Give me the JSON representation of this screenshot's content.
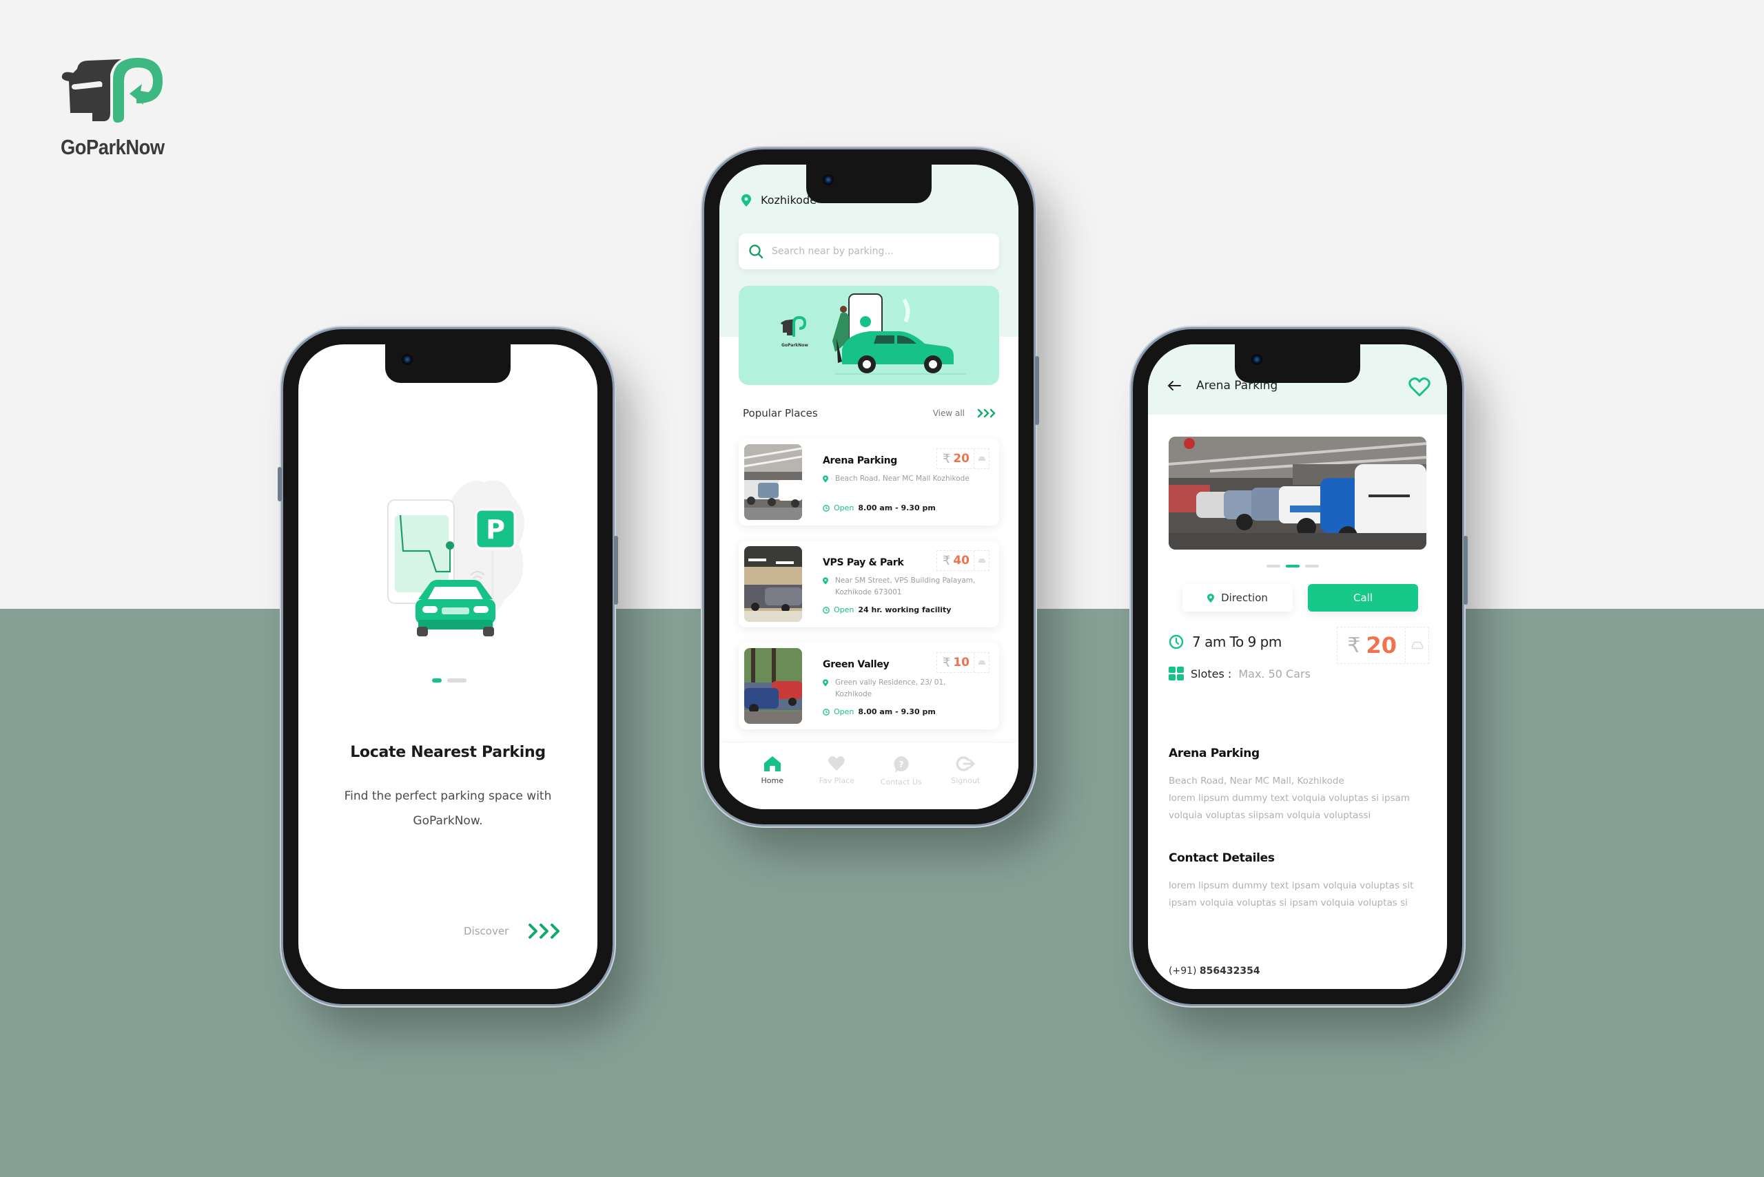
{
  "brand": {
    "name": "GoParkNow",
    "primary_color": "#16c287",
    "dark_color": "#3a3a3a",
    "price_color": "#f0734d"
  },
  "onboarding": {
    "title": "Locate Nearest Parking",
    "subtitle_line1": "Find the perfect parking space with",
    "subtitle_line2": "GoParkNow.",
    "pager": {
      "current": 1,
      "total": 2
    },
    "discover_label": "Discover",
    "discover_icon": "triple-chevron-right-icon",
    "illustration": "car-parking-map-illustration"
  },
  "home": {
    "location": "Kozhikode",
    "search_placeholder": "Search near by parking...",
    "banner": {
      "brand": "GoParkNow",
      "illustration": "person-with-green-car-and-phone-map"
    },
    "section_title": "Popular Places",
    "view_all_label": "View all",
    "currency_symbol": "₹",
    "places": [
      {
        "name": "Arena Parking",
        "price": "20",
        "address": "Beach Road, Near MC Mall Kozhikode",
        "status": "Open",
        "hours": "8.00 am - 9.30 pm",
        "image": "indoor-parking-garage"
      },
      {
        "name": "VPS Pay & Park",
        "price": "40",
        "address": "Near SM Street, VPS Building Palayam, Kozhikode 673001",
        "status": "Open",
        "hours": "24 hr. working facility",
        "image": "basement-parking-lot"
      },
      {
        "name": "Green Valley",
        "price": "10",
        "address": "Green vally Residence, 23/ 01, Kozhikode",
        "status": "Open",
        "hours": "8.00 am - 9.30 pm",
        "image": "outdoor-parking-trees"
      }
    ],
    "nav": [
      {
        "label": "Home",
        "icon": "home-icon",
        "active": true
      },
      {
        "label": "Fav Place",
        "icon": "heart-icon",
        "active": false
      },
      {
        "label": "Contact Us",
        "icon": "help-chat-icon",
        "active": false
      },
      {
        "label": "Signout",
        "icon": "signout-icon",
        "active": false
      }
    ]
  },
  "detail": {
    "title": "Arena Parking",
    "image": "indoor-parking-garage",
    "carousel": {
      "current": 2,
      "total": 3
    },
    "direction_label": "Direction",
    "call_label": "Call",
    "hours": "7 am To 9 pm",
    "slots_label": "Slotes :",
    "slots_value": "Max. 50 Cars",
    "currency_symbol": "₹",
    "price": "20",
    "place_heading": "Arena Parking",
    "place_text": [
      "Beach Road, Near MC Mall, Kozhikode",
      "lorem lipsum dummy text  volquia voluptas si ipsam",
      "volquia voluptas siipsam volquia voluptassi"
    ],
    "contact_heading": "Contact Detailes",
    "contact_text": [
      "lorem lipsum dummy text  ipsam volquia voluptas sit",
      "ipsam volquia voluptas si ipsam volquia voluptas si"
    ],
    "phone_prefix": "(+91)",
    "phone_number": "856432354"
  }
}
